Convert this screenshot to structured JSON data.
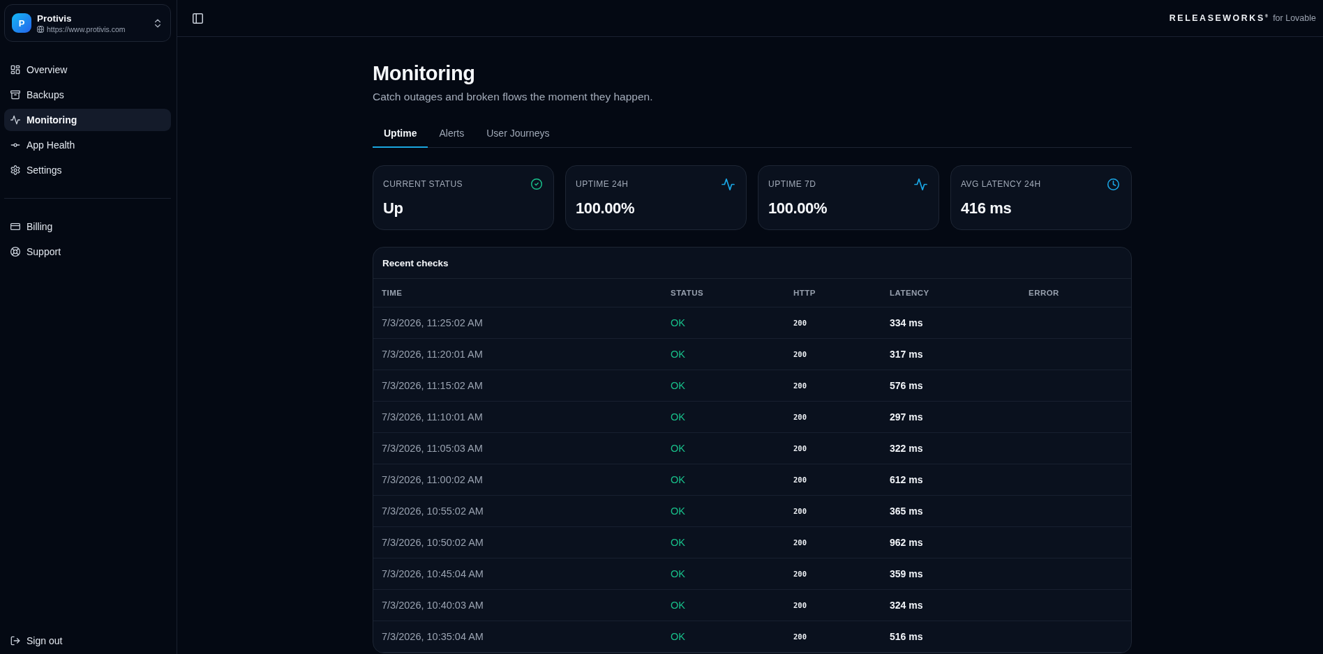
{
  "sidebar": {
    "project": {
      "avatar": "P",
      "name": "Protivis",
      "url": "https://www.protivis.com"
    },
    "nav": [
      {
        "label": "Overview",
        "selected": false
      },
      {
        "label": "Backups",
        "selected": false
      },
      {
        "label": "Monitoring",
        "selected": true
      },
      {
        "label": "App Health",
        "selected": false
      },
      {
        "label": "Settings",
        "selected": false
      }
    ],
    "secondary_nav": [
      {
        "label": "Billing",
        "selected": false
      },
      {
        "label": "Support",
        "selected": false
      }
    ],
    "sign_out": "Sign out"
  },
  "top_bar": {
    "brand": "RELEASEWORKS$^{®}$",
    "brand_suffix": "for Lovable"
  },
  "header": {
    "title": "Monitoring",
    "subtitle": "Catch outages and broken flows the moment they happen."
  },
  "tabs": [
    {
      "label": "Uptime",
      "selected": true
    },
    {
      "label": "Alerts",
      "selected": false
    },
    {
      "label": "User Journeys",
      "selected": false
    }
  ],
  "stats": [
    {
      "label": "CURRENT STATUS",
      "value": "Up"
    },
    {
      "label": "UPTIME 24H",
      "value": "100.00%"
    },
    {
      "label": "UPTIME 7D",
      "value": "100.00%"
    },
    {
      "label": "AVG LATENCY 24H",
      "value": "416 ms"
    }
  ],
  "recent_checks": {
    "title": "Recent checks",
    "columns": [
      "TIME",
      "STATUS",
      "HTTP",
      "LATENCY",
      "ERROR"
    ],
    "rows": [
      {
        "time": "7/3/2026, 11:25:02 AM",
        "status": "OK",
        "http": "200",
        "latency": "334 ms"
      },
      {
        "time": "7/3/2026, 11:20:01 AM",
        "status": "OK",
        "http": "200",
        "latency": "317 ms"
      },
      {
        "time": "7/3/2026, 11:15:02 AM",
        "status": "OK",
        "http": "200",
        "latency": "576 ms"
      },
      {
        "time": "7/3/2026, 11:10:01 AM",
        "status": "OK",
        "http": "200",
        "latency": "297 ms"
      },
      {
        "time": "7/3/2026, 11:05:03 AM",
        "status": "OK",
        "http": "200",
        "latency": "322 ms"
      },
      {
        "time": "7/3/2026, 11:00:02 AM",
        "status": "OK",
        "http": "200",
        "latency": "612 ms"
      },
      {
        "time": "7/3/2026, 10:55:02 AM",
        "status": "OK",
        "http": "200",
        "latency": "365 ms"
      },
      {
        "time": "7/3/2026, 10:50:02 AM",
        "status": "OK",
        "http": "200",
        "latency": "962 ms"
      },
      {
        "time": "7/3/2026, 10:45:04 AM",
        "status": "OK",
        "http": "200",
        "latency": "359 ms"
      },
      {
        "time": "7/3/2026, 10:40:03 AM",
        "status": "OK",
        "http": "200",
        "latency": "324 ms"
      },
      {
        "time": "7/3/2026, 10:35:04 AM",
        "status": "OK",
        "http": "200",
        "latency": "516 ms"
      }
    ]
  }
}
